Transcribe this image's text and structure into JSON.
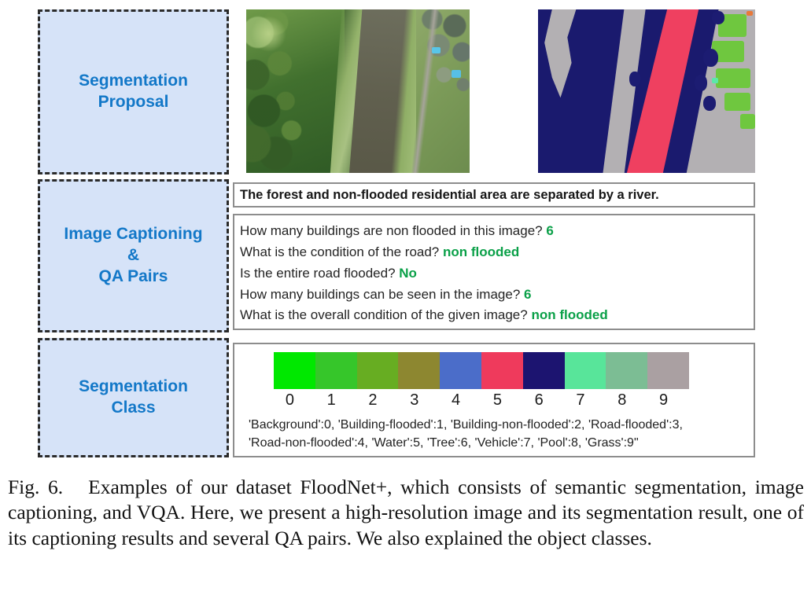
{
  "figure": {
    "row_labels": {
      "segmentation_proposal": "Segmentation\nProposal",
      "image_captioning_qa": "Image Captioning\n&\nQA Pairs",
      "segmentation_class": "Segmentation\nClass"
    },
    "images": {
      "aerial_photo_alt": "Aerial photo of a river with forest on the left bank and non-flooded residential area on the right bank",
      "segmentation_mask_alt": "Color-coded semantic segmentation mask: navy trees, gray grass, pink water, green buildings"
    },
    "caption_text": "The forest and non-flooded residential area are separated by a river.",
    "qa_pairs": [
      {
        "question": "How many buildings are non flooded in this image?",
        "answer": "6"
      },
      {
        "question": "What is the condition of the road?",
        "answer": "non flooded"
      },
      {
        "question": "Is the entire road flooded?",
        "answer": "No"
      },
      {
        "question": "How many buildings can be seen in the image?",
        "answer": "6"
      },
      {
        "question": "What is the overall condition of the given image?",
        "answer": "non flooded"
      }
    ],
    "segmentation_class": {
      "tick_labels": [
        "0",
        "1",
        "2",
        "3",
        "4",
        "5",
        "6",
        "7",
        "8",
        "9"
      ],
      "swatch_colors": [
        "#00e800",
        "#36c62a",
        "#67ad22",
        "#8d8730",
        "#4b6dc9",
        "#ef3a5c",
        "#1c1470",
        "#58e59a",
        "#7cbd94",
        "#aaa0a2"
      ],
      "class_list_line1": "'Background':0, 'Building-flooded':1, 'Building-non-flooded':2, 'Road-flooded':3,",
      "class_list_line2": "'Road-non-flooded':4, 'Water':5, 'Tree':6, 'Vehicle':7, 'Pool':8, 'Grass':9\"",
      "classes": [
        {
          "name": "Background",
          "index": 0
        },
        {
          "name": "Building-flooded",
          "index": 1
        },
        {
          "name": "Building-non-flooded",
          "index": 2
        },
        {
          "name": "Road-flooded",
          "index": 3
        },
        {
          "name": "Road-non-flooded",
          "index": 4
        },
        {
          "name": "Water",
          "index": 5
        },
        {
          "name": "Tree",
          "index": 6
        },
        {
          "name": "Vehicle",
          "index": 7
        },
        {
          "name": "Pool",
          "index": 8
        },
        {
          "name": "Grass",
          "index": 9
        }
      ]
    }
  },
  "figure_caption": {
    "number": "Fig. 6.",
    "text": "Examples of our dataset FloodNet+, which consists of semantic segmentation, image captioning, and VQA. Here, we present a high-resolution image and its segmentation result, one of its captioning results and several QA pairs. We also explained the object classes."
  },
  "colors": {
    "label_box_fill": "#d6e3f8",
    "label_box_border": "#2b2b2b",
    "label_text": "#1378c8",
    "answer_green": "#0aa048",
    "box_border": "#8d8d8d"
  }
}
